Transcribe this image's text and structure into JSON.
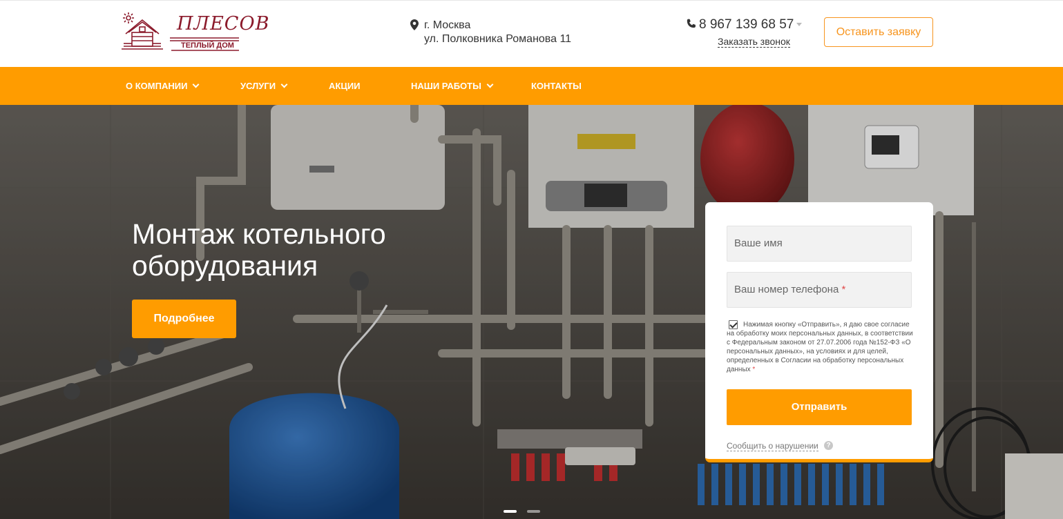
{
  "header": {
    "logo": {
      "name": "ПЛЕСОВ",
      "tagline": "ТЕПЛЫЙ ДОМ"
    },
    "address": {
      "city": "г. Москва",
      "street": "ул. Полковника Романова 11"
    },
    "phone": "8 967 139 68 57",
    "callback_label": "Заказать звонок",
    "order_button": "Оставить заявку"
  },
  "nav": {
    "items": [
      {
        "label": "О компании",
        "dropdown": true
      },
      {
        "label": "Услуги",
        "dropdown": true
      },
      {
        "label": "Акции",
        "dropdown": false
      },
      {
        "label": "Наши работы",
        "dropdown": true
      },
      {
        "label": "Контакты",
        "dropdown": false
      }
    ]
  },
  "hero": {
    "title_line1": "Монтаж котельного",
    "title_line2": "оборудования",
    "more_button": "Подробнее",
    "slides_count": 2,
    "active_slide": 1
  },
  "form": {
    "name_placeholder": "Ваше имя",
    "phone_placeholder": "Ваш номер телефона",
    "required_mark": "*",
    "consent_checked": true,
    "consent_text": "Нажимая кнопку «Отправить», я даю свое согласие на обработку моих персональных данных, в соответствии с Федеральным законом от 27.07.2006 года №152-ФЗ «О персональных данных», на условиях и для целей, определенных в Согласии на обработку персональных данных",
    "submit_button": "Отправить",
    "report_link": "Сообщить о нарушении",
    "help_icon": "?"
  },
  "colors": {
    "accent": "#ff9c00",
    "logo": "#8b1a2b"
  },
  "icons": {
    "address": "map-pin-icon",
    "phone": "phone-icon",
    "help": "question-icon"
  }
}
